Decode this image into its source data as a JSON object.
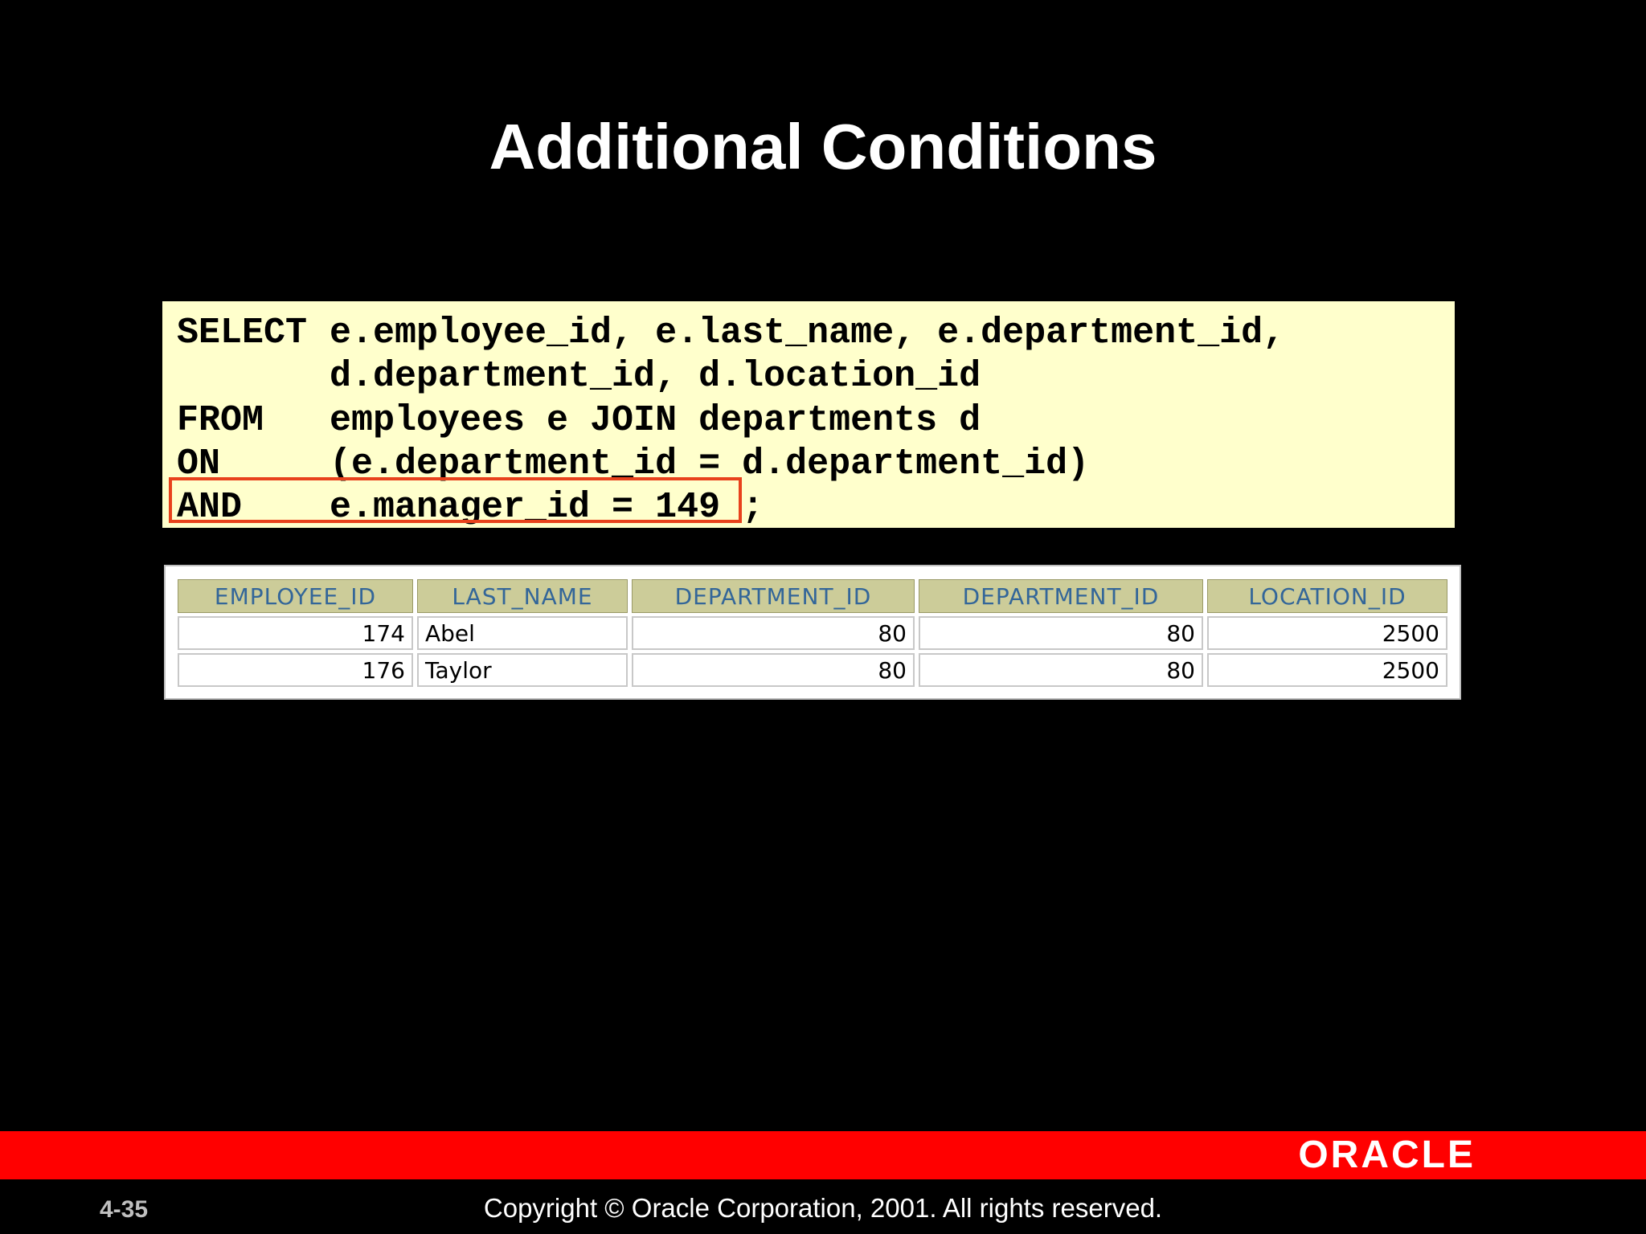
{
  "slide": {
    "title": "Additional Conditions",
    "number": "4-35",
    "copyright": "Copyright © Oracle Corporation, 2001. All rights reserved.",
    "logo_text": "ORACLE",
    "colors": {
      "background": "#000000",
      "code_bg": "#ffffcc",
      "highlight": "#e8421c",
      "footer_bar": "#ff0000",
      "header_bg": "#cccc99",
      "header_text": "#336699"
    }
  },
  "code": {
    "lines": [
      {
        "keyword": "SELECT",
        "text": "e.employee_id, e.last_name, e.department_id,"
      },
      {
        "keyword": "",
        "text": "d.department_id, d.location_id"
      },
      {
        "keyword": "FROM",
        "text": "employees e JOIN departments d"
      },
      {
        "keyword": "ON",
        "text": "(e.department_id = d.department_id)"
      },
      {
        "keyword": "AND",
        "text": "e.manager_id = 149 ;"
      }
    ]
  },
  "result": {
    "columns": [
      "EMPLOYEE_ID",
      "LAST_NAME",
      "DEPARTMENT_ID",
      "DEPARTMENT_ID",
      "LOCATION_ID"
    ],
    "rows": [
      [
        "174",
        "Abel",
        "80",
        "80",
        "2500"
      ],
      [
        "176",
        "Taylor",
        "80",
        "80",
        "2500"
      ]
    ]
  }
}
